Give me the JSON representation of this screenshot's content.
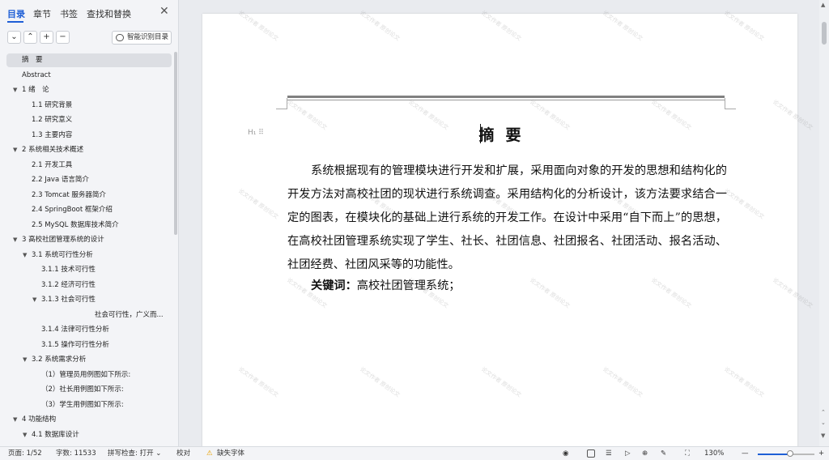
{
  "nav": {
    "tabs": [
      "目录",
      "章节",
      "书签",
      "查找和替换"
    ],
    "close": "✕",
    "tool_buttons": [
      "⌄",
      "⌃",
      "+",
      "−"
    ],
    "smart_button": "智能识别目录",
    "toc": [
      {
        "label": "摘　要",
        "level": 0,
        "arrow": "",
        "selected": true
      },
      {
        "label": "Abstract",
        "level": 0,
        "arrow": ""
      },
      {
        "label": "1  绪　论",
        "level": 0,
        "arrow": "▼"
      },
      {
        "label": "1.1  研究背景",
        "level": 1,
        "arrow": ""
      },
      {
        "label": "1.2  研究意义",
        "level": 1,
        "arrow": ""
      },
      {
        "label": "1.3  主要内容",
        "level": 1,
        "arrow": ""
      },
      {
        "label": "2 系统相关技术概述",
        "level": 0,
        "arrow": "▼"
      },
      {
        "label": "2.1 开发工具",
        "level": 1,
        "arrow": ""
      },
      {
        "label": "2.2 Java 语言简介",
        "level": 1,
        "arrow": ""
      },
      {
        "label": "2.3 Tomcat 服务器简介",
        "level": 1,
        "arrow": ""
      },
      {
        "label": "2.4 SpringBoot 框架介绍",
        "level": 1,
        "arrow": ""
      },
      {
        "label": "2.5 MySQL 数据库技术简介",
        "level": 1,
        "arrow": ""
      },
      {
        "label": "3  高校社团管理系统的设计",
        "level": 0,
        "arrow": "▼"
      },
      {
        "label": "3.1 系统可行性分析",
        "level": 1,
        "arrow": "▼"
      },
      {
        "label": "3.1.1 技术可行性",
        "level": 2,
        "arrow": ""
      },
      {
        "label": "3.1.2 经济可行性",
        "level": 2,
        "arrow": ""
      },
      {
        "label": "3.1.3 社会可行性",
        "level": 2,
        "arrow": "▼"
      },
      {
        "label": "社会可行性，广义而...",
        "level": 3,
        "arrow": ""
      },
      {
        "label": "3.1.4 法律可行性分析",
        "level": 2,
        "arrow": ""
      },
      {
        "label": "3.1.5   操作可行性分析",
        "level": 2,
        "arrow": ""
      },
      {
        "label": "3.2  系统需求分析",
        "level": 1,
        "arrow": "▼"
      },
      {
        "label": "（1）管理员用例图如下所示:",
        "level": 2,
        "arrow": ""
      },
      {
        "label": "（2）社长用例图如下所示:",
        "level": 2,
        "arrow": ""
      },
      {
        "label": "（3）学生用例图如下所示:",
        "level": 2,
        "arrow": ""
      },
      {
        "label": "4 功能结构",
        "level": 0,
        "arrow": "▼"
      },
      {
        "label": "4.1  数据库设计",
        "level": 1,
        "arrow": "▼"
      }
    ]
  },
  "doc": {
    "heading_marker": "H₁ ⠿",
    "title": "摘要",
    "paragraph": "系统根据现有的管理模块进行开发和扩展，采用面向对象的开发的思想和结构化的开发方法对高校社团的现状进行系统调查。采用结构化的分析设计，该方法要求结合一定的图表，在模块化的基础上进行系统的开发工作。在设计中采用“自下而上”的思想，在高校社团管理系统实现了学生、社长、社团信息、社团报名、社团活动、报名活动、社团经费、社团风采等的功能性。",
    "keywords_label": "关键词：",
    "keywords": "高校社团管理系统；",
    "watermark": "论文作者 原创论文"
  },
  "status": {
    "page": "页面: 1/52",
    "words": "字数: 11533",
    "spell": "拼写检查: 打开 ⌄",
    "proof": "校对",
    "missing_font": "缺失字体",
    "warn_icon": "⚠",
    "zoom": "130%",
    "zoom_minus": "—",
    "zoom_plus": "+",
    "zoom_level": 0.57
  }
}
